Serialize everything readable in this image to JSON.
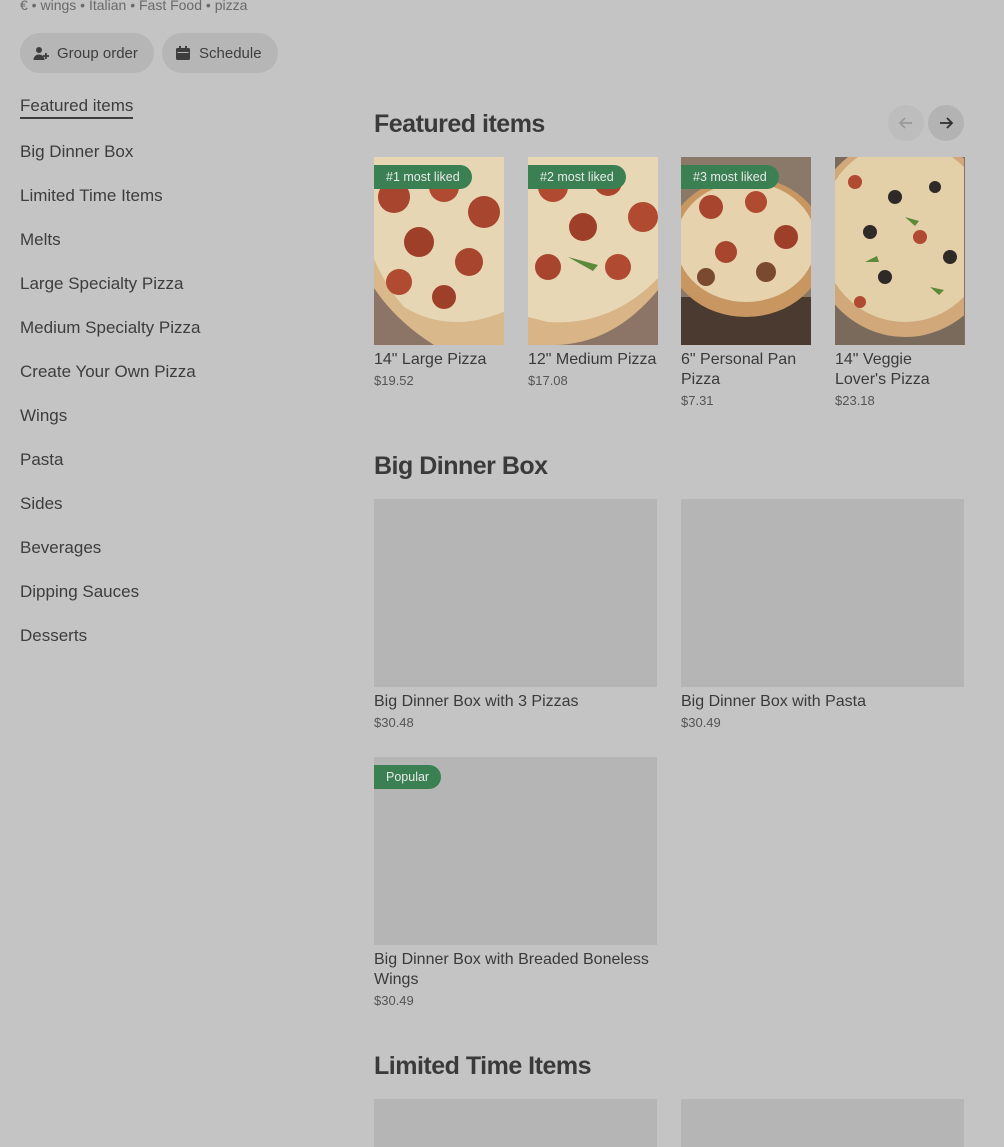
{
  "header": {
    "tagline": "€ • wings • Italian • Fast Food • pizza",
    "group_order": "Group order",
    "schedule": "Schedule"
  },
  "sidebar": {
    "items": [
      {
        "label": "Featured items"
      },
      {
        "label": "Big Dinner Box"
      },
      {
        "label": "Limited Time Items"
      },
      {
        "label": "Melts"
      },
      {
        "label": "Large Specialty Pizza"
      },
      {
        "label": "Medium Specialty Pizza"
      },
      {
        "label": "Create Your Own Pizza"
      },
      {
        "label": "Wings"
      },
      {
        "label": "Pasta"
      },
      {
        "label": "Sides"
      },
      {
        "label": "Beverages"
      },
      {
        "label": "Dipping Sauces"
      },
      {
        "label": "Desserts"
      }
    ]
  },
  "featured": {
    "title": "Featured items",
    "items": [
      {
        "badge": "#1 most liked",
        "name": "14\" Large Pizza",
        "price": "$19.52"
      },
      {
        "badge": "#2 most liked",
        "name": "12\" Medium Pizza",
        "price": "$17.08"
      },
      {
        "badge": "#3 most liked",
        "name": "6\" Personal Pan Pizza",
        "price": "$7.31"
      },
      {
        "badge": "",
        "name": "14\" Veggie Lover's Pizza",
        "price": "$23.18"
      }
    ]
  },
  "big_dinner_box": {
    "title": "Big Dinner Box",
    "items": [
      {
        "name": "Big Dinner Box with 3 Pizzas",
        "price": "$30.48",
        "badge": ""
      },
      {
        "name": "Big Dinner Box with Pasta",
        "price": "$30.49",
        "badge": ""
      },
      {
        "name": "Big Dinner Box with Breaded Boneless Wings",
        "price": "$30.49",
        "badge": "Popular"
      }
    ]
  },
  "limited_time": {
    "title": "Limited Time Items"
  },
  "colors": {
    "overlay_bg": "#c4c4c4",
    "badge_green": "#3a8052"
  }
}
